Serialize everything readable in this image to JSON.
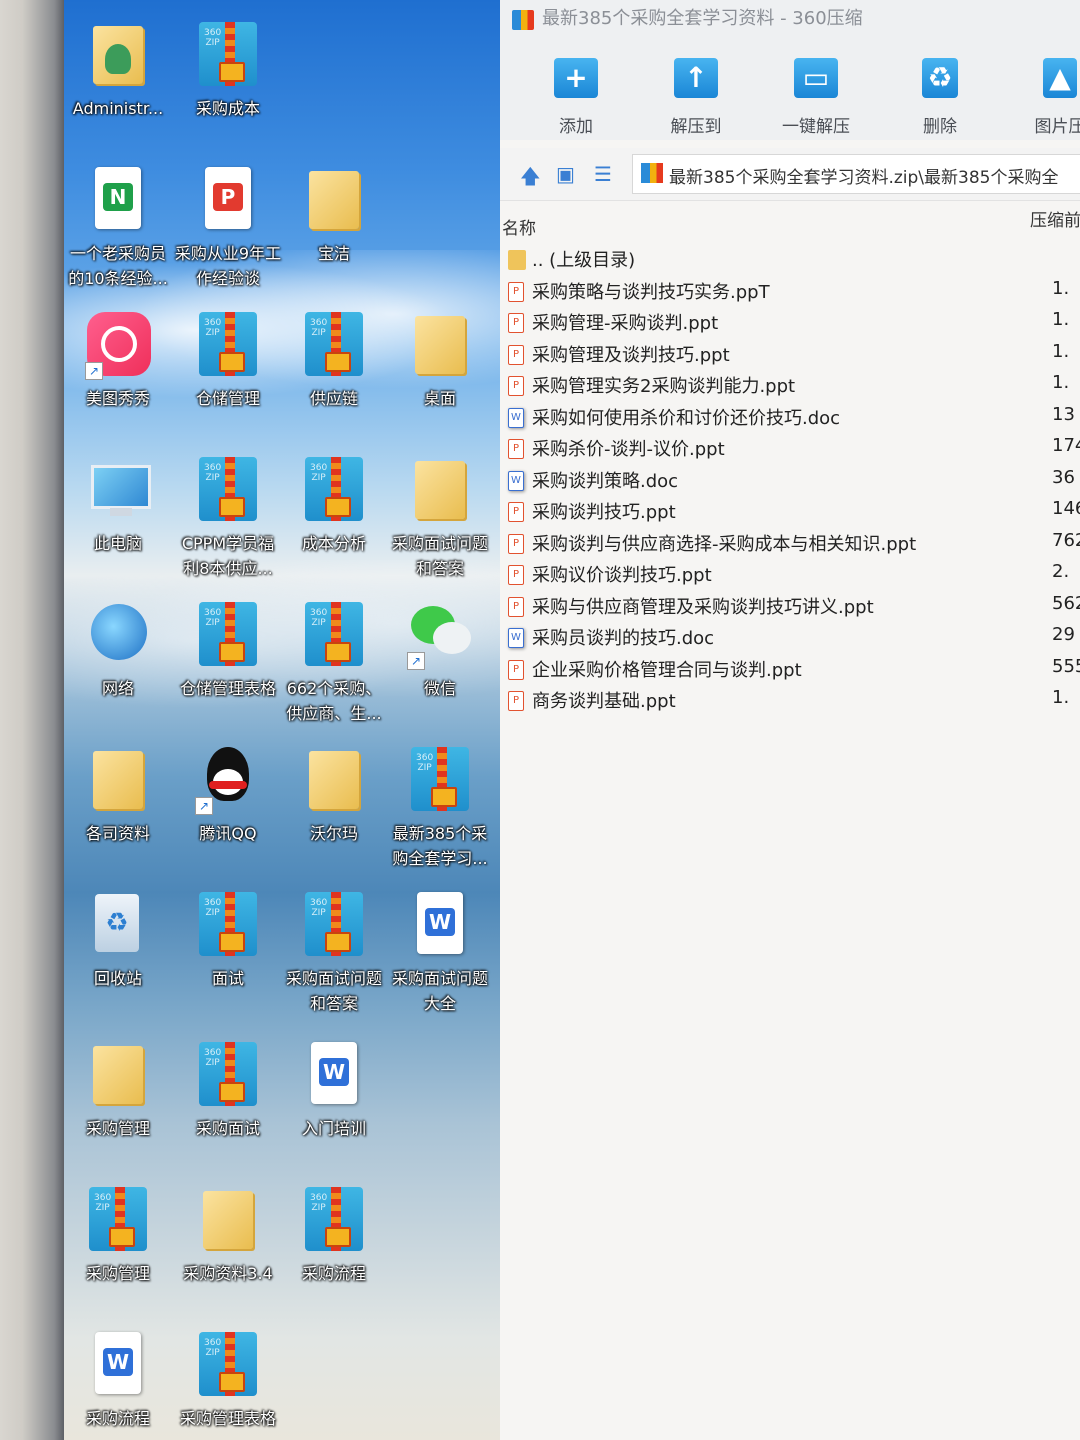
{
  "window": {
    "title": "最新385个采购全套学习资料 - 360压缩",
    "toolbar": [
      {
        "label": "添加",
        "icon": "add-icon"
      },
      {
        "label": "解压到",
        "icon": "extract-to-icon"
      },
      {
        "label": "一键解压",
        "icon": "one-click-extract-icon"
      },
      {
        "label": "删除",
        "icon": "delete-icon"
      },
      {
        "label": "图片压",
        "icon": "image-compress-icon"
      }
    ],
    "path": "最新385个采购全套学习资料.zip\\最新385个采购全",
    "columns": {
      "name": "名称",
      "size": "压缩前"
    },
    "files": [
      {
        "name": ".. (上级目录)",
        "type": "up",
        "size": ""
      },
      {
        "name": "采购策略与谈判技巧实务.ppT",
        "type": "ppt",
        "size": "1."
      },
      {
        "name": "采购管理-采购谈判.ppt",
        "type": "ppt",
        "size": "1."
      },
      {
        "name": "采购管理及谈判技巧.ppt",
        "type": "ppt",
        "size": "1."
      },
      {
        "name": "采购管理实务2采购谈判能力.ppt",
        "type": "ppt",
        "size": "1."
      },
      {
        "name": "采购如何使用杀价和讨价还价技巧.doc",
        "type": "doc",
        "size": "13"
      },
      {
        "name": "采购杀价-谈判-议价.ppt",
        "type": "ppt",
        "size": "174"
      },
      {
        "name": "采购谈判策略.doc",
        "type": "doc",
        "size": "36"
      },
      {
        "name": "采购谈判技巧.ppt",
        "type": "ppt",
        "size": "146"
      },
      {
        "name": "采购谈判与供应商选择-采购成本与相关知识.ppt",
        "type": "ppt",
        "size": "762"
      },
      {
        "name": "采购议价谈判技巧.ppt",
        "type": "ppt",
        "size": "2."
      },
      {
        "name": "采购与供应商管理及采购谈判技巧讲义.ppt",
        "type": "ppt",
        "size": "562"
      },
      {
        "name": "采购员谈判的技巧.doc",
        "type": "doc",
        "size": "29"
      },
      {
        "name": "企业采购价格管理合同与谈判.ppt",
        "type": "ppt",
        "size": "555"
      },
      {
        "name": "商务谈判基础.ppt",
        "type": "ppt",
        "size": "1."
      }
    ]
  },
  "desktop": {
    "icons": [
      {
        "label": "Administr...",
        "icon": "user-folder-icon"
      },
      {
        "label": "采购成本",
        "icon": "zip-archive-icon"
      },
      {
        "label": "一个老采购员的10条经验...",
        "icon": "spreadsheet-doc-icon"
      },
      {
        "label": "采购从业9年工作经验谈",
        "icon": "pdf-doc-icon"
      },
      {
        "label": "宝洁",
        "icon": "folder-icon"
      },
      {
        "label": "美图秀秀",
        "icon": "meitu-app-icon"
      },
      {
        "label": "仓储管理",
        "icon": "zip-archive-icon"
      },
      {
        "label": "供应链",
        "icon": "zip-archive-icon"
      },
      {
        "label": "桌面",
        "icon": "folder-icon"
      },
      {
        "label": "此电脑",
        "icon": "computer-icon"
      },
      {
        "label": "CPPM学员福利8本供应...",
        "icon": "zip-archive-icon"
      },
      {
        "label": "成本分析",
        "icon": "zip-archive-icon"
      },
      {
        "label": "采购面试问题和答案",
        "icon": "folder-icon"
      },
      {
        "label": "网络",
        "icon": "network-globe-icon"
      },
      {
        "label": "仓储管理表格",
        "icon": "zip-archive-icon"
      },
      {
        "label": "662个采购、供应商、生...",
        "icon": "zip-archive-icon"
      },
      {
        "label": "微信",
        "icon": "wechat-app-icon"
      },
      {
        "label": "各司资料",
        "icon": "folder-icon"
      },
      {
        "label": "腾讯QQ",
        "icon": "qq-app-icon"
      },
      {
        "label": "沃尔玛",
        "icon": "folder-icon"
      },
      {
        "label": "最新385个采购全套学习...",
        "icon": "zip-archive-icon"
      },
      {
        "label": "回收站",
        "icon": "recycle-bin-icon"
      },
      {
        "label": "面试",
        "icon": "zip-archive-icon"
      },
      {
        "label": "采购面试问题和答案",
        "icon": "zip-archive-icon"
      },
      {
        "label": "采购面试问题大全",
        "icon": "word-doc-icon"
      },
      {
        "label": "采购管理",
        "icon": "folder-icon"
      },
      {
        "label": "采购面试",
        "icon": "zip-archive-icon"
      },
      {
        "label": "入门培训",
        "icon": "word-doc-icon"
      },
      {
        "label": "采购管理",
        "icon": "zip-archive-icon"
      },
      {
        "label": "采购资料3.4",
        "icon": "folder-icon"
      },
      {
        "label": "采购流程",
        "icon": "zip-archive-icon"
      },
      {
        "label": "采购流程",
        "icon": "word-doc-icon"
      },
      {
        "label": "采购管理表格",
        "icon": "zip-archive-icon"
      }
    ]
  }
}
